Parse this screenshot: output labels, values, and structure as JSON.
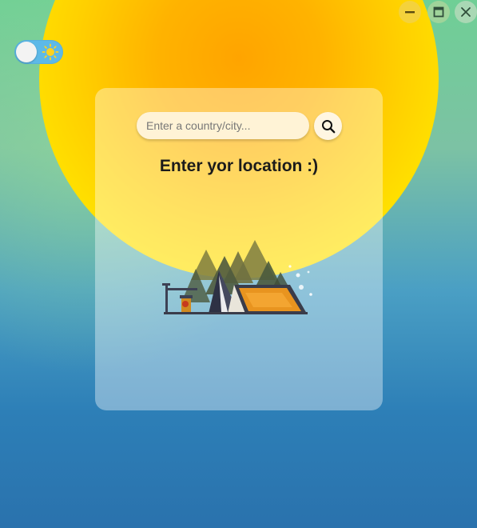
{
  "window_controls": {
    "minimize_icon": "minimize-icon",
    "maximize_icon": "maximize-icon",
    "close_icon": "close-icon"
  },
  "theme_toggle": {
    "state": "light",
    "icon": "sun-icon"
  },
  "search": {
    "placeholder": "Enter a country/city...",
    "value": "",
    "button_icon": "search-icon"
  },
  "main": {
    "message": "Enter yor location :)",
    "illustration": "camping-tent-illustration"
  },
  "colors": {
    "sun": "#ffc400",
    "toggle_bg": "#5db9e8",
    "minimize_btn": "#f4d23c",
    "tent": "#e8941f",
    "text": "#1b1b1b"
  }
}
